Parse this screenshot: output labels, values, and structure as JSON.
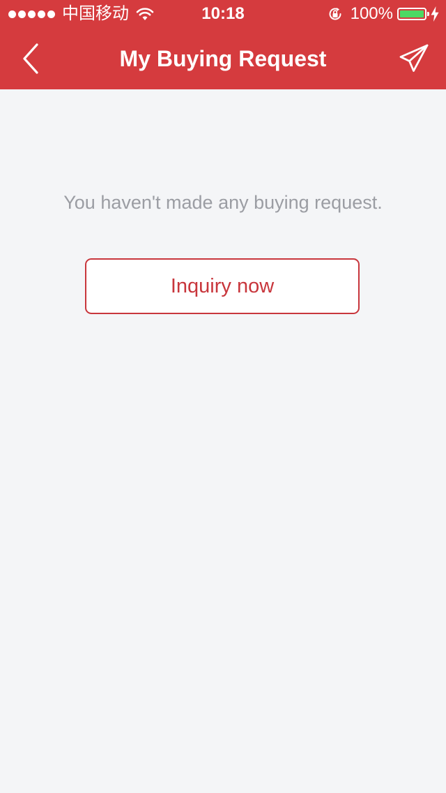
{
  "status_bar": {
    "carrier": "中国移动",
    "time": "10:18",
    "battery_percent": "100%",
    "battery_level": 1.0,
    "icons": [
      "signal-dots",
      "wifi-icon",
      "rotation-lock-icon",
      "battery-icon",
      "charging-bolt-icon"
    ]
  },
  "header": {
    "title": "My Buying Request",
    "back_icon": "chevron-left-icon",
    "action_icon": "paper-plane-send-icon"
  },
  "main": {
    "empty_message": "You haven't made any buying request.",
    "inquiry_button_label": "Inquiry now"
  },
  "colors": {
    "header_bg": "#d53b3e",
    "page_bg": "#f4f5f7",
    "accent": "#c8363c",
    "muted_text": "#9b9da3",
    "battery_fill": "#4cd964"
  }
}
